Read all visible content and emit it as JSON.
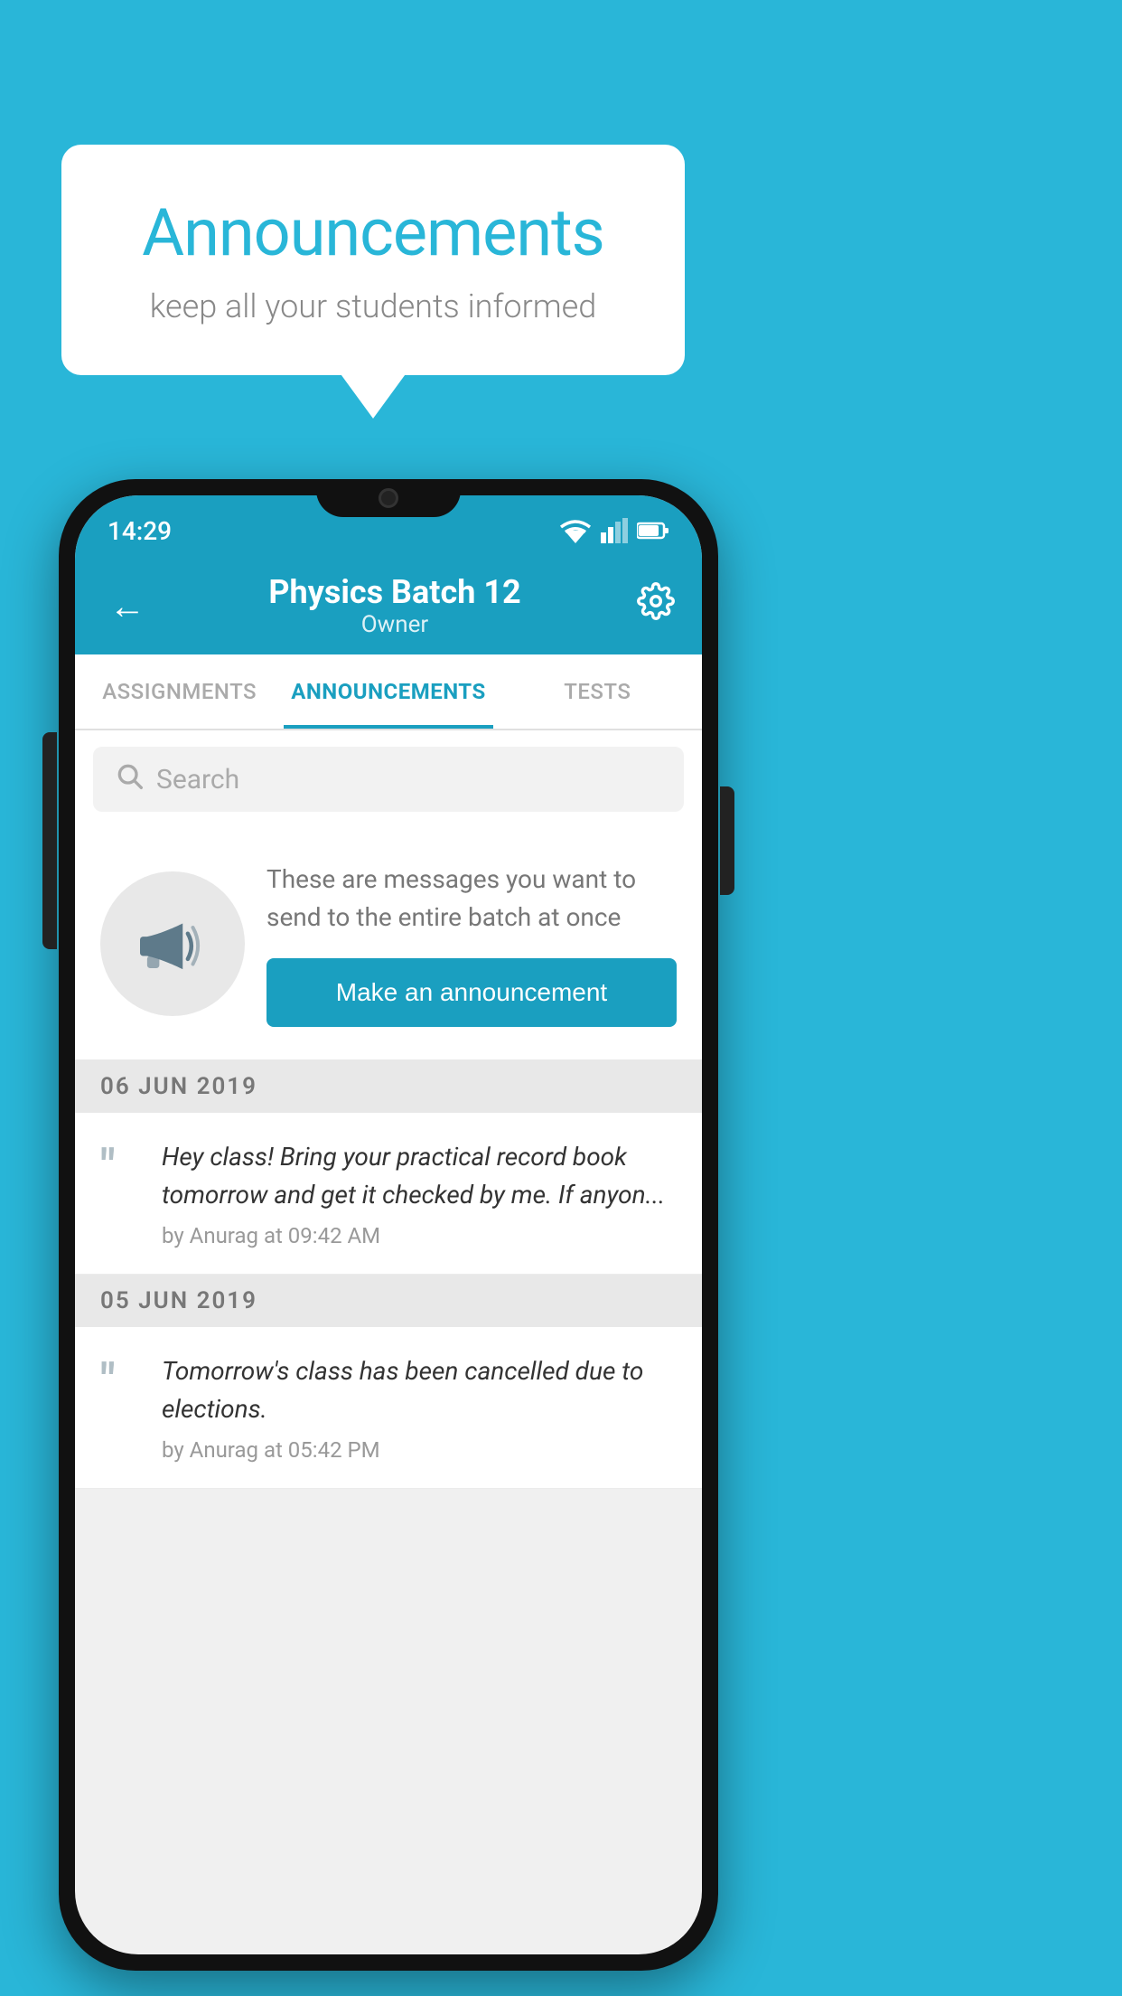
{
  "background_color": "#29b6d8",
  "speech_bubble": {
    "title": "Announcements",
    "subtitle": "keep all your students informed"
  },
  "phone": {
    "status_bar": {
      "time": "14:29"
    },
    "toolbar": {
      "title": "Physics Batch 12",
      "subtitle": "Owner",
      "back_icon": "←",
      "settings_icon": "⚙"
    },
    "tabs": [
      {
        "label": "ASSIGNMENTS",
        "active": false
      },
      {
        "label": "ANNOUNCEMENTS",
        "active": true
      },
      {
        "label": "TESTS",
        "active": false
      }
    ],
    "search": {
      "placeholder": "Search"
    },
    "promo": {
      "description": "These are messages you want to send to the entire batch at once",
      "button_label": "Make an announcement"
    },
    "announcements": [
      {
        "date": "06  JUN  2019",
        "items": [
          {
            "text": "Hey class! Bring your practical record book tomorrow and get it checked by me. If anyon...",
            "meta": "by Anurag at 09:42 AM"
          }
        ]
      },
      {
        "date": "05  JUN  2019",
        "items": [
          {
            "text": "Tomorrow's class has been cancelled due to elections.",
            "meta": "by Anurag at 05:42 PM"
          }
        ]
      }
    ]
  }
}
